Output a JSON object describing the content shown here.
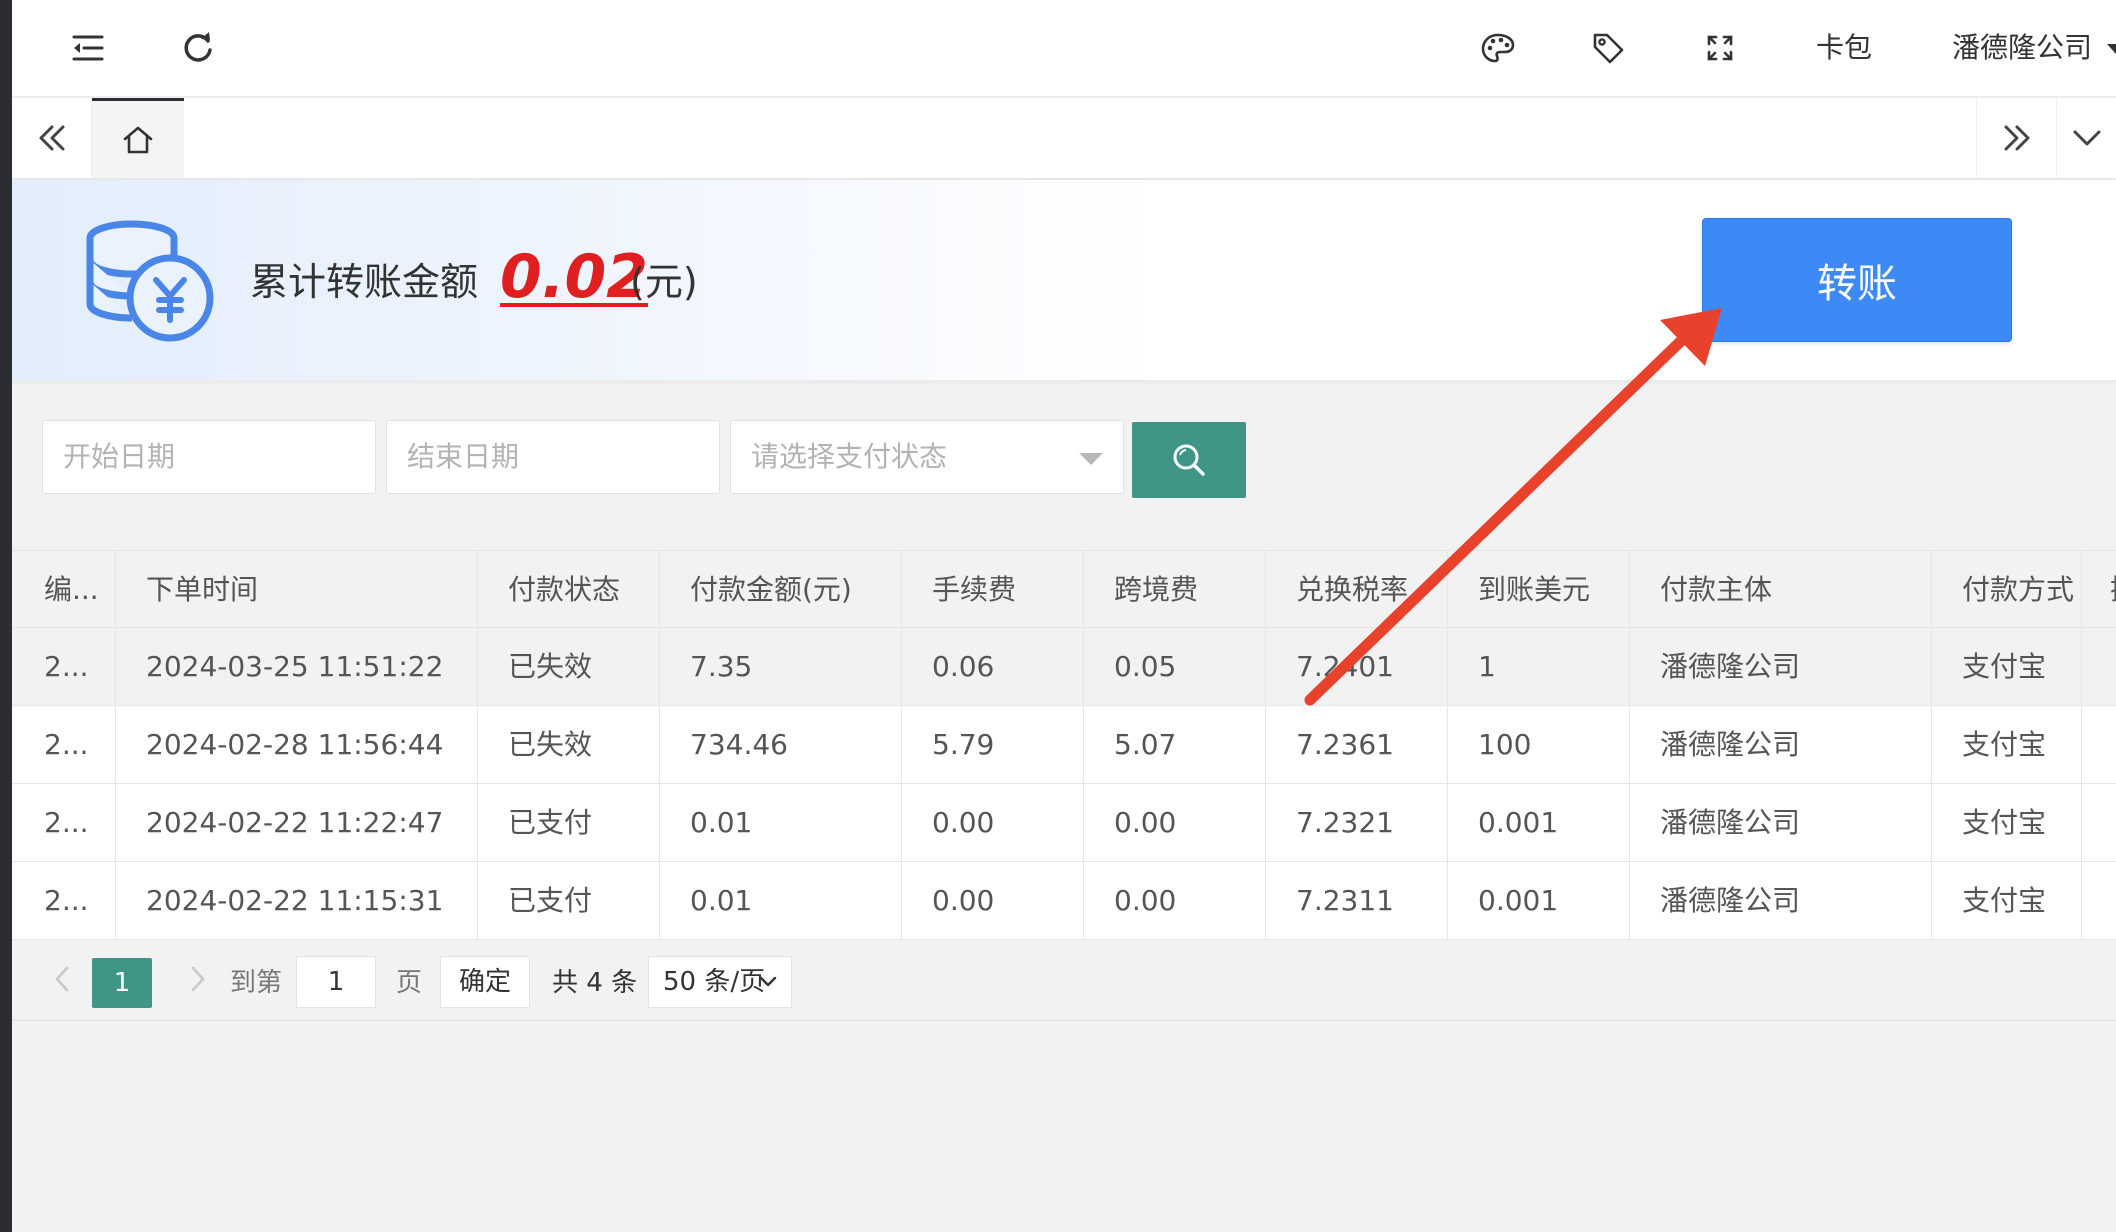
{
  "header": {
    "menu_icon": "menu-fold-icon",
    "refresh_icon": "refresh-icon",
    "theme_icon": "palette-icon",
    "tag_icon": "tag-icon",
    "fullscreen_icon": "fullscreen-icon",
    "card_wallet": "卡包",
    "company": "潘德隆公司"
  },
  "tabs": {
    "prev_icon": "double-left-icon",
    "home_icon": "home-icon",
    "next_icon": "double-right-icon",
    "dropdown_icon": "chevron-down-icon"
  },
  "banner": {
    "icon": "coins-yuan-icon",
    "label": "累计转账金额",
    "amount": "0.02",
    "unit": "(元)",
    "transfer_button": "转账"
  },
  "filters": {
    "start_date_placeholder": "开始日期",
    "end_date_placeholder": "结束日期",
    "status_placeholder": "请选择支付状态",
    "search_icon": "search-icon"
  },
  "table": {
    "columns": [
      "编...",
      "下单时间",
      "付款状态",
      "付款金额(元)",
      "手续费",
      "跨境费",
      "兑换税率",
      "到账美元",
      "付款主体",
      "付款方式",
      "操"
    ],
    "rows": [
      [
        "2...",
        "2024-03-25 11:51:22",
        "已失效",
        "7.35",
        "0.06",
        "0.05",
        "7.2401",
        "1",
        "潘德隆公司",
        "支付宝",
        ""
      ],
      [
        "2...",
        "2024-02-28 11:56:44",
        "已失效",
        "734.46",
        "5.79",
        "5.07",
        "7.2361",
        "100",
        "潘德隆公司",
        "支付宝",
        ""
      ],
      [
        "2...",
        "2024-02-22 11:22:47",
        "已支付",
        "0.01",
        "0.00",
        "0.00",
        "7.2321",
        "0.001",
        "潘德隆公司",
        "支付宝",
        ""
      ],
      [
        "2...",
        "2024-02-22 11:15:31",
        "已支付",
        "0.01",
        "0.00",
        "0.00",
        "7.2311",
        "0.001",
        "潘德隆公司",
        "支付宝",
        ""
      ]
    ]
  },
  "pagination": {
    "current_page": "1",
    "goto_label": "到第",
    "goto_value": "1",
    "page_unit": "页",
    "confirm": "确定",
    "total": "共 4 条",
    "page_size": "50 条/页"
  },
  "colors": {
    "primary_button": "#3d8af7",
    "accent_green": "#3f9686",
    "amount_red": "#e02020",
    "annotation_arrow": "#e8412c"
  }
}
